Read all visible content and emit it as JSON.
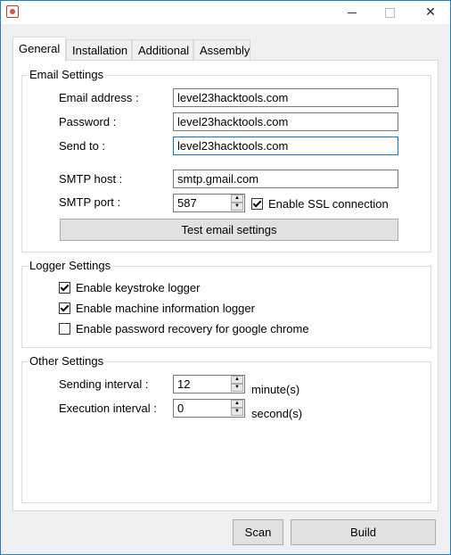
{
  "window": {
    "icon": "app-icon",
    "minimize_label": "",
    "maximize_label": "",
    "close_label": "✕"
  },
  "tabs": [
    {
      "label": "General",
      "active": true
    },
    {
      "label": "Installation",
      "active": false
    },
    {
      "label": "Additional",
      "active": false
    },
    {
      "label": "Assembly",
      "active": false
    }
  ],
  "email_settings": {
    "title": "Email Settings",
    "email_label": "Email address :",
    "email_value": "level23hacktools.com",
    "password_label": "Password :",
    "password_value": "level23hacktools.com",
    "sendto_label": "Send to :",
    "sendto_value": "level23hacktools.com",
    "smtp_host_label": "SMTP host :",
    "smtp_host_value": "smtp.gmail.com",
    "smtp_port_label": "SMTP port :",
    "smtp_port_value": "587",
    "ssl_label": "Enable SSL connection",
    "ssl_checked": true,
    "test_button": "Test email settings"
  },
  "logger_settings": {
    "title": "Logger Settings",
    "keystroke_label": "Enable keystroke logger",
    "keystroke_checked": true,
    "machine_label": "Enable machine information logger",
    "machine_checked": true,
    "chrome_label": "Enable password recovery for google chrome",
    "chrome_checked": false
  },
  "other_settings": {
    "title": "Other Settings",
    "sending_label": "Sending interval :",
    "sending_value": "12",
    "sending_unit": "minute(s)",
    "execution_label": "Execution interval :",
    "execution_value": "0",
    "execution_unit": "second(s)"
  },
  "footer": {
    "scan_button": "Scan",
    "build_button": "Build"
  }
}
